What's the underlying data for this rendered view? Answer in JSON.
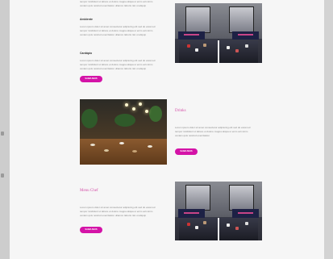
{
  "sections": [
    {
      "id": "top",
      "subheadings": [
        "Ambiente",
        "Cardápio"
      ],
      "body_lines": [
        "Lorem ipsum dolor sit amet consectetur adipiscing elit sed do eiusmod",
        "tempor incididunt ut labore et dolore magna aliqua ut enim ad minim",
        "veniam quis nostrud exercitation ullamco laboris nisi ut aliquip"
      ],
      "button_label": "SAIBA MAIS"
    },
    {
      "id": "middle",
      "heading": "Drinks",
      "body_lines": [
        "Lorem ipsum dolor sit amet consectetur adipiscing elit sed do eiusmod",
        "tempor incididunt ut labore et dolore magna aliqua ut enim ad minim",
        "veniam quis nostrud exercitation"
      ],
      "button_label": "SAIBA MAIS"
    },
    {
      "id": "bottom",
      "heading": "Menu Chef",
      "body_lines": [
        "Lorem ipsum dolor sit amet consectetur adipiscing elit sed do eiusmod",
        "tempor incididunt ut labore et dolore magna aliqua ut enim ad minim",
        "veniam quis nostrud exercitation ullamco laboris nisi ut aliquip"
      ],
      "button_label": "SAIBA MAIS"
    }
  ],
  "colors": {
    "accent": "#d413a7",
    "heading": "#d44fa8",
    "text": "#8a8a8a"
  },
  "images": {
    "top": "mirrors-photo",
    "middle": "restaurant-photo",
    "bottom": "mirrors-photo"
  }
}
